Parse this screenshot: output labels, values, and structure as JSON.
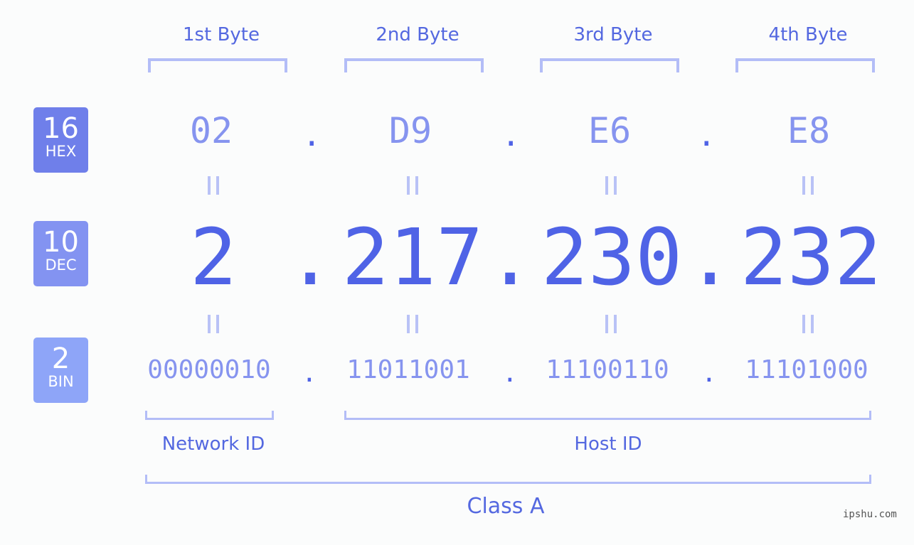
{
  "bases": [
    {
      "num": "16",
      "label": "HEX",
      "color": "#6f7fea"
    },
    {
      "num": "10",
      "label": "DEC",
      "color": "#8393f1"
    },
    {
      "num": "2",
      "label": "BIN",
      "color": "#8ea5f8"
    }
  ],
  "byte_headers": [
    "1st Byte",
    "2nd Byte",
    "3rd Byte",
    "4th Byte"
  ],
  "hex": [
    "02",
    "D9",
    "E6",
    "E8"
  ],
  "dec": [
    "2",
    "217",
    "230",
    "232"
  ],
  "bin": [
    "00000010",
    "11011001",
    "11100110",
    "11101000"
  ],
  "separator": ".",
  "labels": {
    "network": "Network ID",
    "host": "Host ID",
    "class": "Class A"
  },
  "watermark": "ipshu.com"
}
